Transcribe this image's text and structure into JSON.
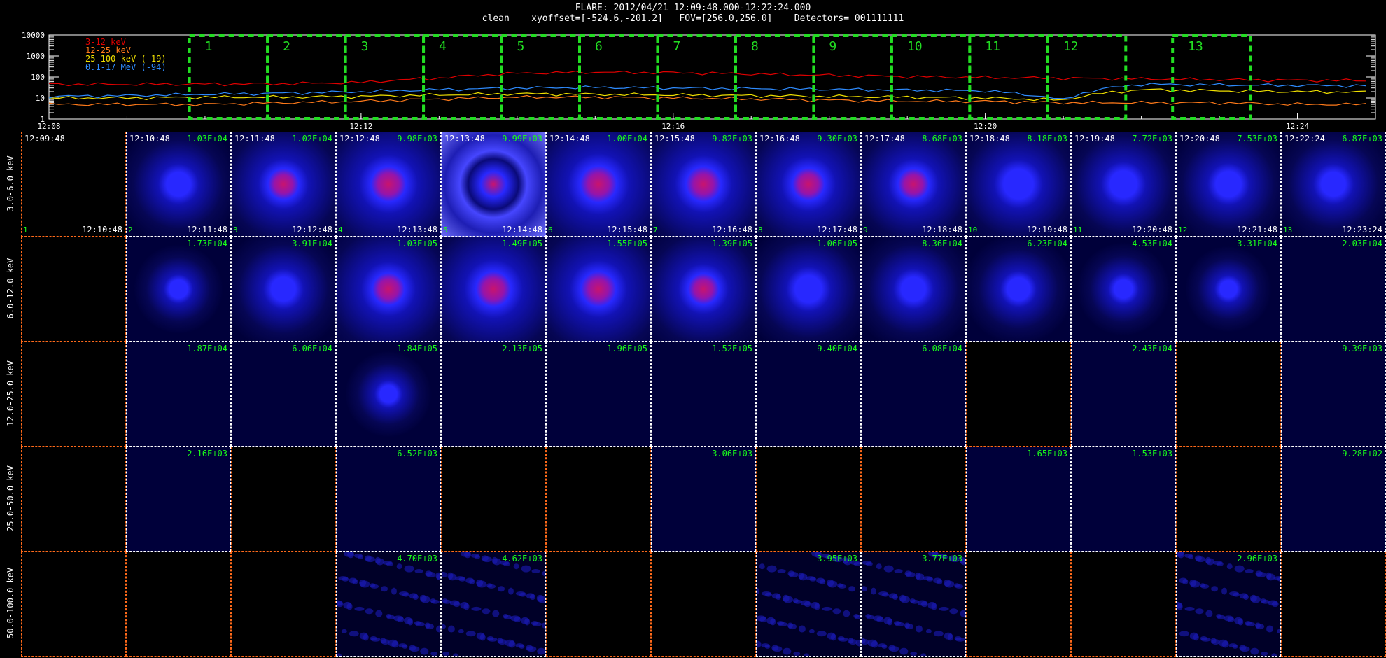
{
  "header": {
    "line1": "FLARE: 2012/04/21 12:09:48.000-12:22:24.000",
    "line2": "clean    xyoffset=[-524.6,-201.2]   FOV=[256.0,256.0]    Detectors= 001111111"
  },
  "lightcurve": {
    "y_ticks": [
      "10000",
      "1000",
      "100",
      "10",
      "1"
    ],
    "x_ticks": [
      "12:08",
      "12:12",
      "12:16",
      "12:20",
      "12:24"
    ],
    "legend": [
      {
        "label": "3-12 keV",
        "color": "#e00000"
      },
      {
        "label": "12-25 keV",
        "color": "#ff7a1a"
      },
      {
        "label": "25-100 keV (-19)",
        "color": "#f0e000"
      },
      {
        "label": "0.1-17 MeV (-94)",
        "color": "#2f8cff"
      }
    ],
    "intervals": [
      "1",
      "2",
      "3",
      "4",
      "5",
      "6",
      "7",
      "8",
      "9",
      "10",
      "11",
      "12",
      "13"
    ]
  },
  "chart_data": {
    "type": "line",
    "title": "FLARE: 2012/04/21 12:09:48.000-12:22:24.000",
    "xlabel": "",
    "ylabel": "",
    "y_scale": "log",
    "ylim": [
      1,
      10000
    ],
    "xlim": [
      "12:08",
      "12:25"
    ],
    "x": [
      "12:08",
      "12:09",
      "12:10",
      "12:11",
      "12:12",
      "12:13",
      "12:14",
      "12:15",
      "12:16",
      "12:17",
      "12:18",
      "12:19",
      "12:20",
      "12:21",
      "12:22",
      "12:23",
      "12:24",
      "12:25"
    ],
    "series": [
      {
        "name": "3-12 keV",
        "values": [
          45,
          45,
          46,
          48,
          55,
          90,
          150,
          170,
          160,
          140,
          120,
          105,
          95,
          88,
          82,
          75,
          70,
          68
        ]
      },
      {
        "name": "12-25 keV",
        "values": [
          5,
          5,
          5,
          6,
          7,
          9,
          11,
          11,
          10,
          9,
          8,
          7,
          7,
          6,
          6,
          6,
          5,
          5
        ]
      },
      {
        "name": "25-100 keV (-19)",
        "values": [
          10,
          10,
          11,
          11,
          12,
          14,
          16,
          15,
          14,
          13,
          12,
          11,
          10,
          8,
          25,
          22,
          20,
          19
        ]
      },
      {
        "name": "0.1-17 MeV (-94)",
        "values": [
          12,
          13,
          15,
          17,
          20,
          25,
          30,
          32,
          30,
          28,
          26,
          24,
          22,
          8,
          45,
          42,
          40,
          38
        ]
      }
    ],
    "intervals": [
      {
        "label": "1",
        "start": "12:09:48",
        "end": "12:10:48"
      },
      {
        "label": "2",
        "start": "12:10:48",
        "end": "12:11:48"
      },
      {
        "label": "3",
        "start": "12:11:48",
        "end": "12:12:48"
      },
      {
        "label": "4",
        "start": "12:12:48",
        "end": "12:13:48"
      },
      {
        "label": "5",
        "start": "12:13:48",
        "end": "12:14:48"
      },
      {
        "label": "6",
        "start": "12:14:48",
        "end": "12:15:48"
      },
      {
        "label": "7",
        "start": "12:15:48",
        "end": "12:16:48"
      },
      {
        "label": "8",
        "start": "12:16:48",
        "end": "12:17:48"
      },
      {
        "label": "9",
        "start": "12:17:48",
        "end": "12:18:48"
      },
      {
        "label": "10",
        "start": "12:18:48",
        "end": "12:19:48"
      },
      {
        "label": "11",
        "start": "12:19:48",
        "end": "12:20:48"
      },
      {
        "label": "12",
        "start": "12:20:48",
        "end": "12:21:48"
      },
      {
        "label": "13",
        "start": "12:22:24",
        "end": "12:23:24"
      }
    ]
  },
  "image_grid": {
    "energy_bands": [
      "3.0-6.0 keV",
      "6.0-12.0 keV",
      "12.0-25.0 keV",
      "25.0-50.0 keV",
      "50.0-100.0 keV"
    ],
    "start_times": [
      "12:09:48",
      "12:10:48",
      "12:11:48",
      "12:12:48",
      "12:13:48",
      "12:14:48",
      "12:15:48",
      "12:16:48",
      "12:17:48",
      "12:18:48",
      "12:19:48",
      "12:20:48",
      "12:22:24"
    ],
    "end_times": [
      "12:10:48",
      "12:11:48",
      "12:12:48",
      "12:13:48",
      "12:14:48",
      "12:15:48",
      "12:16:48",
      "12:17:48",
      "12:18:48",
      "12:19:48",
      "12:20:48",
      "12:21:48",
      "12:23:24"
    ],
    "fluxes": [
      [
        "",
        "1.03E+04",
        "1.02E+04",
        "9.98E+03",
        "9.99E+03",
        "1.00E+04",
        "9.82E+03",
        "9.30E+03",
        "8.68E+03",
        "8.18E+03",
        "7.72E+03",
        "7.53E+03",
        "6.87E+03"
      ],
      [
        "",
        "1.73E+04",
        "3.91E+04",
        "1.03E+05",
        "1.49E+05",
        "1.55E+05",
        "1.39E+05",
        "1.06E+05",
        "8.36E+04",
        "6.23E+04",
        "4.53E+04",
        "3.31E+04",
        "2.03E+04"
      ],
      [
        "",
        "1.87E+04",
        "6.06E+04",
        "1.84E+05",
        "2.13E+05",
        "1.96E+05",
        "1.52E+05",
        "9.40E+04",
        "6.08E+04",
        "",
        "2.43E+04",
        "",
        "9.39E+03"
      ],
      [
        "",
        "2.16E+03",
        "",
        "6.52E+03",
        "",
        "",
        "3.06E+03",
        "",
        "",
        "1.65E+03",
        "1.53E+03",
        "",
        "9.28E+02"
      ],
      [
        "",
        "",
        "",
        "4.70E+03",
        "4.62E+03",
        "",
        "",
        "3.95E+03",
        "3.77E+03",
        "",
        "",
        "2.96E+03",
        ""
      ]
    ],
    "source_intensity": [
      [
        0,
        0.35,
        0.6,
        0.8,
        0.9,
        0.85,
        0.75,
        0.7,
        0.6,
        0.55,
        0.45,
        0.4,
        0.35
      ],
      [
        0,
        0.1,
        0.35,
        0.7,
        0.8,
        0.75,
        0.6,
        0.45,
        0.35,
        0.25,
        0.12,
        0.08,
        0
      ],
      [
        0,
        0,
        0,
        0.05,
        0,
        0,
        0,
        0,
        0,
        0,
        0,
        0,
        0
      ],
      [
        0,
        0,
        0,
        0,
        0,
        0,
        0,
        0,
        0,
        0,
        0,
        0,
        0
      ],
      [
        0,
        0,
        0,
        0,
        0,
        0,
        0,
        0,
        0,
        0,
        0,
        0,
        0
      ]
    ],
    "cell_state": [
      [
        "black",
        "blue",
        "blue",
        "blue",
        "blue",
        "blue",
        "blue",
        "blue",
        "blue",
        "blue",
        "blue",
        "blue",
        "blue"
      ],
      [
        "black",
        "blue",
        "blue",
        "blue",
        "blue",
        "blue",
        "blue",
        "blue",
        "blue",
        "blue",
        "blue",
        "blue",
        "blue"
      ],
      [
        "black",
        "blue",
        "blue",
        "blue",
        "blue",
        "blue",
        "blue",
        "blue",
        "blue",
        "black",
        "blue",
        "black",
        "blue"
      ],
      [
        "black",
        "blue",
        "black",
        "blue",
        "black",
        "black",
        "blue",
        "black",
        "black",
        "blue",
        "blue",
        "black",
        "blue"
      ],
      [
        "black",
        "black",
        "black",
        "noise",
        "noise",
        "black",
        "black",
        "noise",
        "noise",
        "black",
        "black",
        "noise",
        "black"
      ]
    ],
    "indices": [
      "1",
      "2",
      "3",
      "4",
      "5",
      "6",
      "7",
      "8",
      "9",
      "10",
      "11",
      "12",
      "13"
    ]
  },
  "colors": {
    "flux_label": "#1aff1a",
    "interval_box": "#22dd22",
    "grid_white": "#ffffff",
    "grid_orange": "#ff6a1a",
    "image_bg": "#00003a"
  }
}
